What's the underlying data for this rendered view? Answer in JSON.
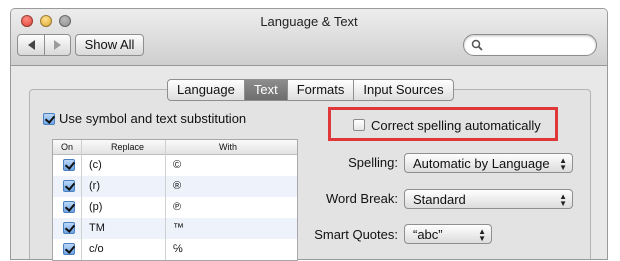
{
  "window": {
    "title": "Language & Text"
  },
  "toolbar": {
    "show_all": "Show All",
    "search_placeholder": ""
  },
  "tabs": [
    {
      "label": "Language",
      "active": false
    },
    {
      "label": "Text",
      "active": true
    },
    {
      "label": "Formats",
      "active": false
    },
    {
      "label": "Input Sources",
      "active": false
    }
  ],
  "substitution": {
    "checkbox_label": "Use symbol and text substitution",
    "checked": true,
    "columns": {
      "on": "On",
      "replace": "Replace",
      "with": "With"
    },
    "rows": [
      {
        "on": true,
        "replace": "(c)",
        "with": "©"
      },
      {
        "on": true,
        "replace": "(r)",
        "with": "®"
      },
      {
        "on": true,
        "replace": "(p)",
        "with": "℗"
      },
      {
        "on": true,
        "replace": "TM",
        "with": "™"
      },
      {
        "on": true,
        "replace": "c/o",
        "with": "℅"
      }
    ]
  },
  "correct_spelling": {
    "label": "Correct spelling automatically",
    "checked": false
  },
  "spelling": {
    "label": "Spelling:",
    "value": "Automatic by Language"
  },
  "word_break": {
    "label": "Word Break:",
    "value": "Standard"
  },
  "smart_quotes": {
    "label": "Smart Quotes:",
    "value": "“abc”"
  },
  "colors": {
    "highlight": "#e0383a",
    "tab_active": "#7a7a7a"
  }
}
